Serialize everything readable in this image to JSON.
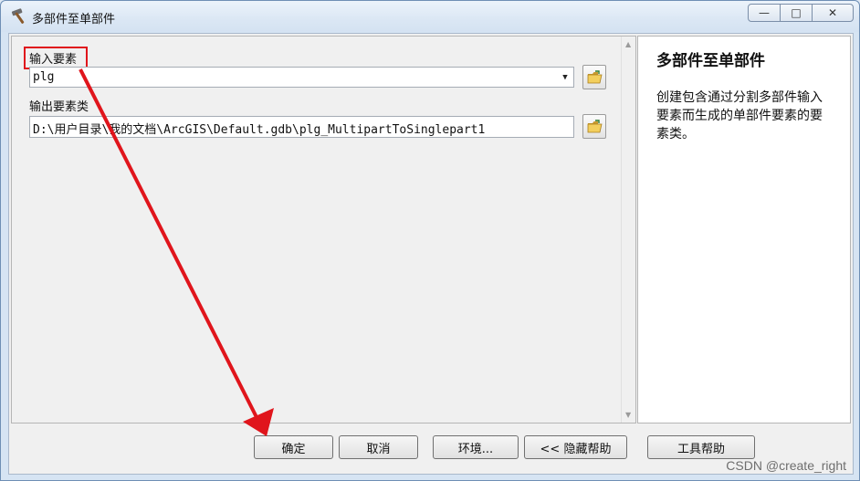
{
  "window": {
    "title": "多部件至单部件",
    "controls": {
      "minimize": "—",
      "maximize": "□",
      "close": "✕"
    }
  },
  "form": {
    "input_label": "输入要素",
    "input_value": "plg",
    "output_label": "输出要素类",
    "output_value": "D:\\用户目录\\我的文档\\ArcGIS\\Default.gdb\\plg_MultipartToSinglepart1"
  },
  "help": {
    "title": "多部件至单部件",
    "body": "创建包含通过分割多部件输入要素而生成的单部件要素的要素类。"
  },
  "buttons": {
    "ok": "确定",
    "cancel": "取消",
    "environments": "环境...",
    "hide_help": "<< 隐藏帮助",
    "tool_help": "工具帮助"
  },
  "watermark": "CSDN @create_right",
  "colors": {
    "annotation": "#e0151c",
    "title_bar": "#dbe7f4"
  }
}
